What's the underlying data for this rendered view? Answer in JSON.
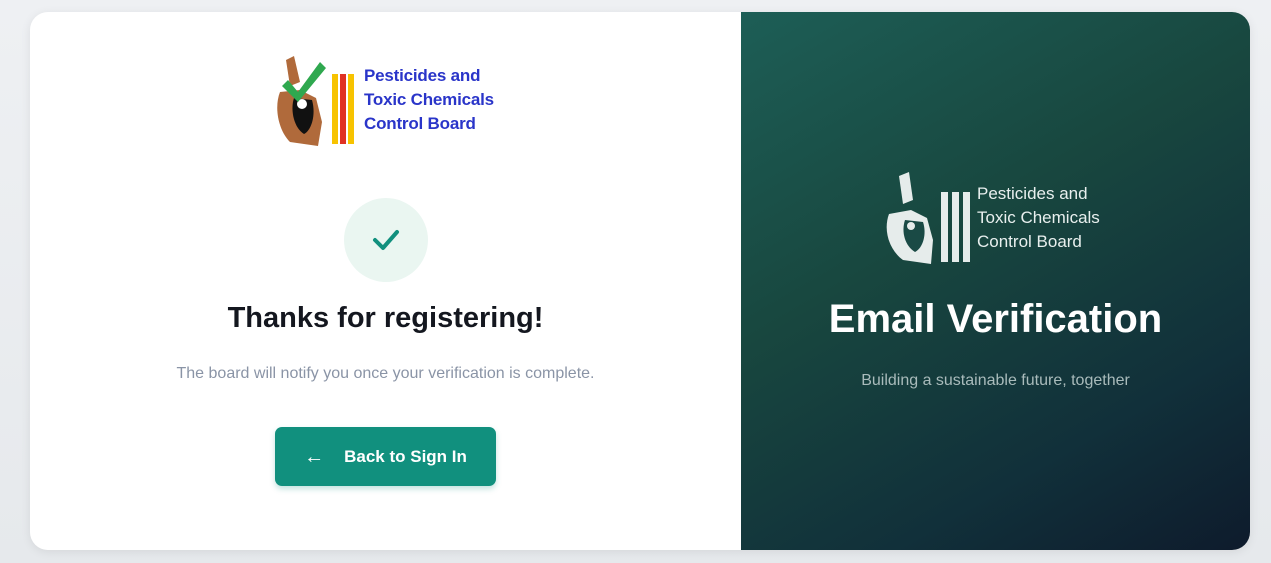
{
  "logo": {
    "line1": "Pesticides and",
    "line2": "Toxic Chemicals",
    "line3": "Control Board"
  },
  "confirmation": {
    "title": "Thanks for registering!",
    "message": "The board will notify you once your verification is complete.",
    "icon": "check-icon"
  },
  "back_button": {
    "icon": "arrow-left-icon",
    "label": "Back to Sign In"
  },
  "side_panel": {
    "title": "Email Verification",
    "tagline": "Building a sustainable future, together"
  },
  "colors": {
    "accent": "#11907e",
    "logo_text": "#2a35c9",
    "panel_dark": "#0e1b2c"
  }
}
